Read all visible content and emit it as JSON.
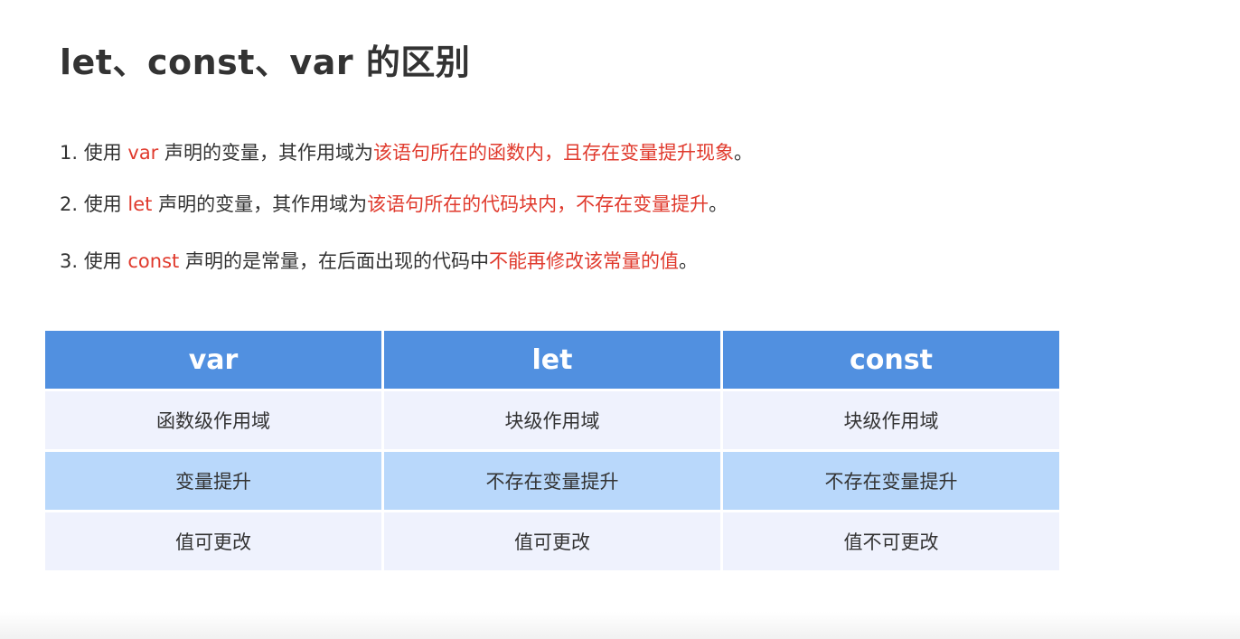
{
  "title": "let、const、var 的区别",
  "points": [
    {
      "pre": "1. 使用 ",
      "kw": "var",
      "mid": " 声明的变量，其作用域为",
      "hl": "该语句所在的函数内，且存在变量提升现象",
      "post": "。"
    },
    {
      "pre": "2. 使用 ",
      "kw": "let",
      "mid": " 声明的变量，其作用域为",
      "hl": "该语句所在的代码块内，不存在变量提升",
      "post": "。"
    },
    {
      "pre": "3. 使用 ",
      "kw": "const",
      "mid": " 声明的是常量，在后面出现的代码中",
      "hl": "不能再修改该常量的值",
      "post": "。"
    }
  ],
  "table": {
    "headers": [
      "var",
      "let",
      "const"
    ],
    "rows": [
      [
        "函数级作用域",
        "块级作用域",
        "块级作用域"
      ],
      [
        "变量提升",
        "不存在变量提升",
        "不存在变量提升"
      ],
      [
        "值可更改",
        "值可更改",
        "值不可更改"
      ]
    ]
  },
  "colors": {
    "header_bg": "#5190e0",
    "row_light": "#eff2fd",
    "row_blue": "#b9d8fb",
    "highlight": "#e03a2d",
    "text": "#333333"
  }
}
